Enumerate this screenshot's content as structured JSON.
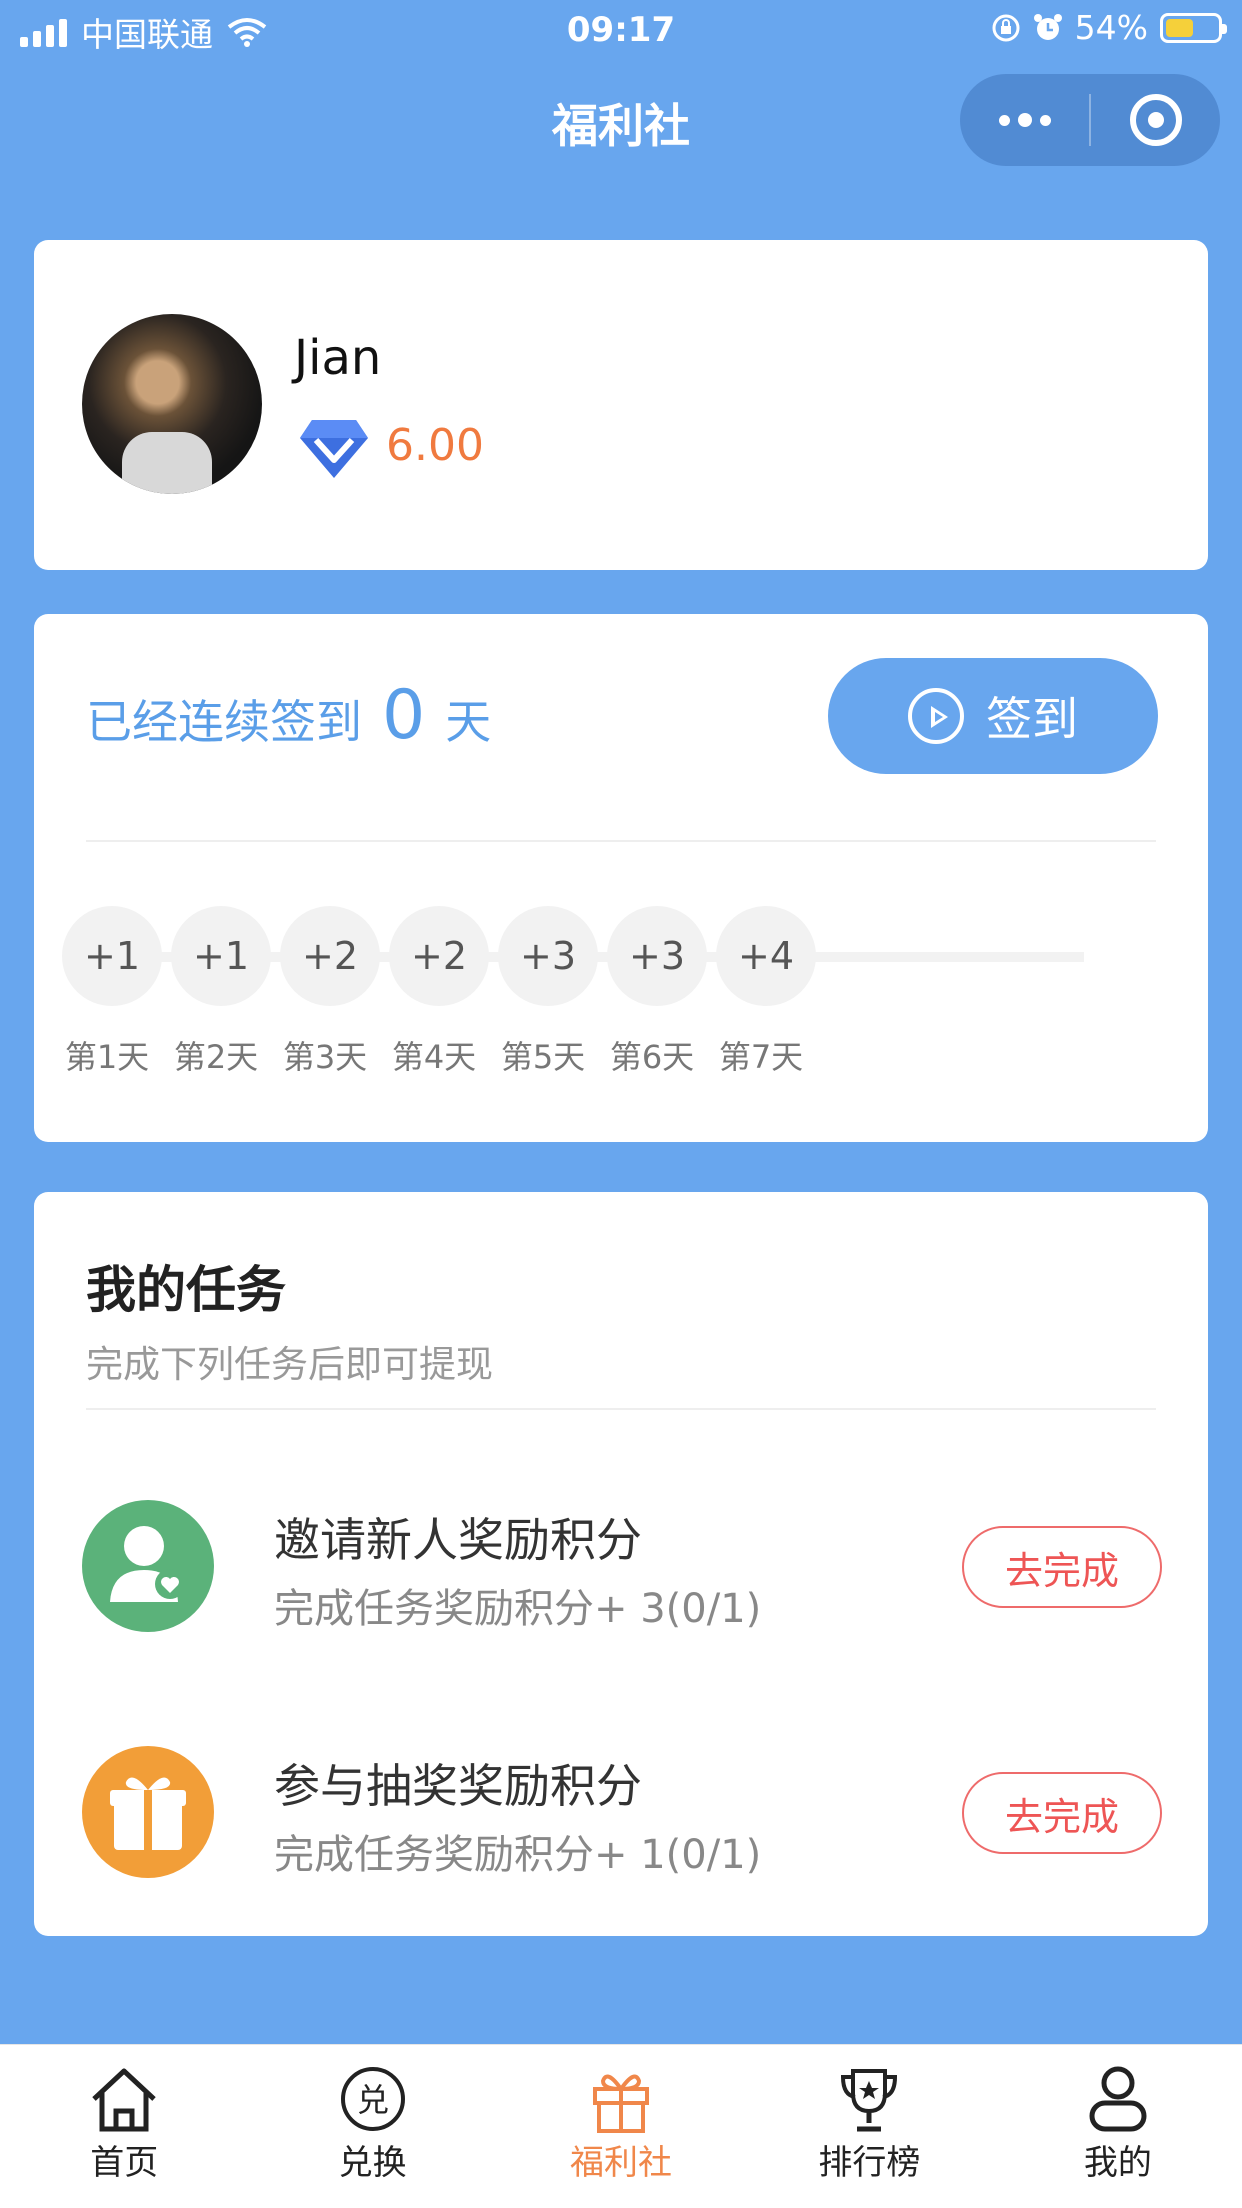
{
  "status_bar": {
    "carrier": "中国联通",
    "time": "09:17",
    "battery": "54%",
    "battery_level": 0.54
  },
  "nav": {
    "title": "福利社",
    "more_icon": "more-dots-icon",
    "close_icon": "target-circle-icon"
  },
  "profile": {
    "name": "Jian",
    "points": "6.00",
    "points_icon": "diamond-icon"
  },
  "signin": {
    "label": "已经连续签到",
    "streak": "0",
    "unit": "天",
    "button": "签到",
    "days": [
      {
        "bonus": "+1",
        "label": "第1天"
      },
      {
        "bonus": "+1",
        "label": "第2天"
      },
      {
        "bonus": "+2",
        "label": "第3天"
      },
      {
        "bonus": "+2",
        "label": "第4天"
      },
      {
        "bonus": "+3",
        "label": "第5天"
      },
      {
        "bonus": "+3",
        "label": "第6天"
      },
      {
        "bonus": "+4",
        "label": "第7天"
      }
    ]
  },
  "tasks": {
    "title": "我的任务",
    "subtitle": "完成下列任务后即可提现",
    "items": [
      {
        "title": "邀请新人奖励积分",
        "desc": "完成任务奖励积分+ 3(0/1)",
        "button": "去完成",
        "icon": "invite-user-icon",
        "color": "#5bb27a"
      },
      {
        "title": "参与抽奖奖励积分",
        "desc": "完成任务奖励积分+ 1(0/1)",
        "button": "去完成",
        "icon": "gift-icon",
        "color": "#f29e38"
      }
    ]
  },
  "tabbar": [
    {
      "label": "首页",
      "icon": "home-icon"
    },
    {
      "label": "兑换",
      "icon": "exchange-icon"
    },
    {
      "label": "福利社",
      "icon": "gift-icon",
      "active": true
    },
    {
      "label": "排行榜",
      "icon": "trophy-icon"
    },
    {
      "label": "我的",
      "icon": "user-icon"
    }
  ]
}
